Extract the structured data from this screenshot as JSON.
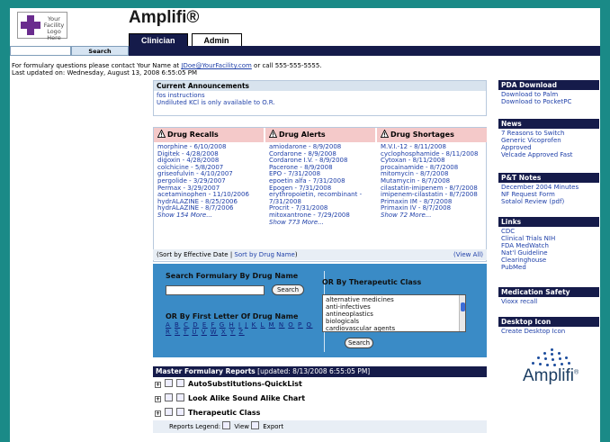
{
  "logo": {
    "text_line1": "Your",
    "text_line2": "Facility",
    "text_line3": "Logo Here"
  },
  "app": {
    "title": "Amplifi®"
  },
  "tabs": [
    {
      "label": "Clinician"
    },
    {
      "label": "Admin"
    }
  ],
  "search": {
    "button_label": "Search"
  },
  "notice": {
    "line1_prefix": "For formulary questions please contact Your Name at ",
    "email": "JDoe@YourFacility.com",
    "line1_suffix": " or call 555-555-5555.",
    "line2": "Last updated on: Wednesday, August 13, 2008 6:55:05 PM"
  },
  "announcements": {
    "title": "Current Announcements",
    "items": [
      "fos instructions",
      "Undiluted KCl is only available to O.R."
    ]
  },
  "drug_recalls": {
    "title": "Drug Recalls",
    "items": [
      "morphine - 6/10/2008",
      "Digitek - 4/28/2008",
      "digoxin - 4/28/2008",
      "colchicine - 5/8/2007",
      "griseofulvin - 4/10/2007",
      "pergolide - 3/29/2007",
      "Permax - 3/29/2007",
      "acetaminophen - 11/10/2006",
      "hydrALAZINE - 8/25/2006",
      "hydrALAZINE - 8/7/2006"
    ],
    "more": "Show 154 More..."
  },
  "drug_alerts": {
    "title": "Drug Alerts",
    "items": [
      "amiodarone - 8/9/2008",
      "Cordarone - 8/9/2008",
      "Cordarone I.V. - 8/9/2008",
      "Pacerone - 8/9/2008",
      "EPO - 7/31/2008",
      "epoetin alfa - 7/31/2008",
      "Epogen - 7/31/2008",
      "erythropoietin, recombinant -",
      "7/31/2008",
      "Procrit - 7/31/2008",
      "mitoxantrone - 7/29/2008"
    ],
    "more": "Show 773 More..."
  },
  "drug_shortages": {
    "title": "Drug Shortages",
    "items": [
      "M.V.I.-12 - 8/11/2008",
      "cyclophosphamide - 8/11/2008",
      "Cytoxan - 8/11/2008",
      "procainamide - 8/7/2008",
      "mitomycin - 8/7/2008",
      "Mutamycin - 8/7/2008",
      "cilastatin-imipenem - 8/7/2008",
      "imipenem-cilastatin - 8/7/2008",
      "Primaxin IM - 8/7/2008",
      "Primaxin IV - 8/7/2008"
    ],
    "more": "Show 72 More..."
  },
  "sortbar": {
    "open": "(Sort by Effective Date | ",
    "link": "Sort by Drug Name",
    "close": ")",
    "view_all": "(View All)"
  },
  "formulary_search": {
    "title_name": "Search Formulary By Drug Name",
    "button_label": "Search",
    "title_letter": "OR By First Letter Of Drug Name",
    "letters": [
      "A",
      "B",
      "C",
      "D",
      "E",
      "F",
      "G",
      "H",
      "I",
      "J",
      "K",
      "L",
      "M",
      "N",
      "O",
      "P",
      "Q",
      "R",
      "S",
      "T",
      "U",
      "V",
      "W",
      "X",
      "Y",
      "Z"
    ],
    "title_class": "OR By Therapeutic Class",
    "classes": [
      "alternative medicines",
      "anti-infectives",
      "antineoplastics",
      "biologicals",
      "cardiovascular agents"
    ],
    "class_button_label": "Search"
  },
  "reports": {
    "title": "Master Formulary Reports",
    "updated": " [updated: 8/13/2008 6:55:05 PM]",
    "rows": [
      "AutoSubstitutions-QuickList",
      "Look Alike Sound Alike Chart",
      "Therapeutic Class"
    ],
    "legend_prefix": "Reports Legend:",
    "legend_view": "View",
    "legend_export": "Export"
  },
  "sidebar": {
    "pda": {
      "title": "PDA Download",
      "items": [
        "Download to Palm",
        "Download to PocketPC"
      ]
    },
    "news": {
      "title": "News",
      "items": [
        "7 Reasons to Switch",
        "Generic Vicoprofen",
        "Approved",
        "Velcade Approved Fast"
      ]
    },
    "pt": {
      "title": "P&T Notes",
      "items": [
        "December 2004 Minutes",
        "NF Request Form",
        "Sotalol Review (pdf)"
      ]
    },
    "links": {
      "title": "Links",
      "items": [
        "CDC",
        "Clinical Trials NIH",
        "FDA MedWatch",
        "Nat'l Guideline",
        "Clearinghouse",
        "PubMed"
      ]
    },
    "safety": {
      "title": "Medication Safety",
      "items": [
        "Vioxx recall"
      ]
    },
    "desktop": {
      "title": "Desktop Icon",
      "items": [
        "Create Desktop Icon"
      ],
      "logo_text": "Amplifi",
      "logo_mark": "®"
    }
  }
}
